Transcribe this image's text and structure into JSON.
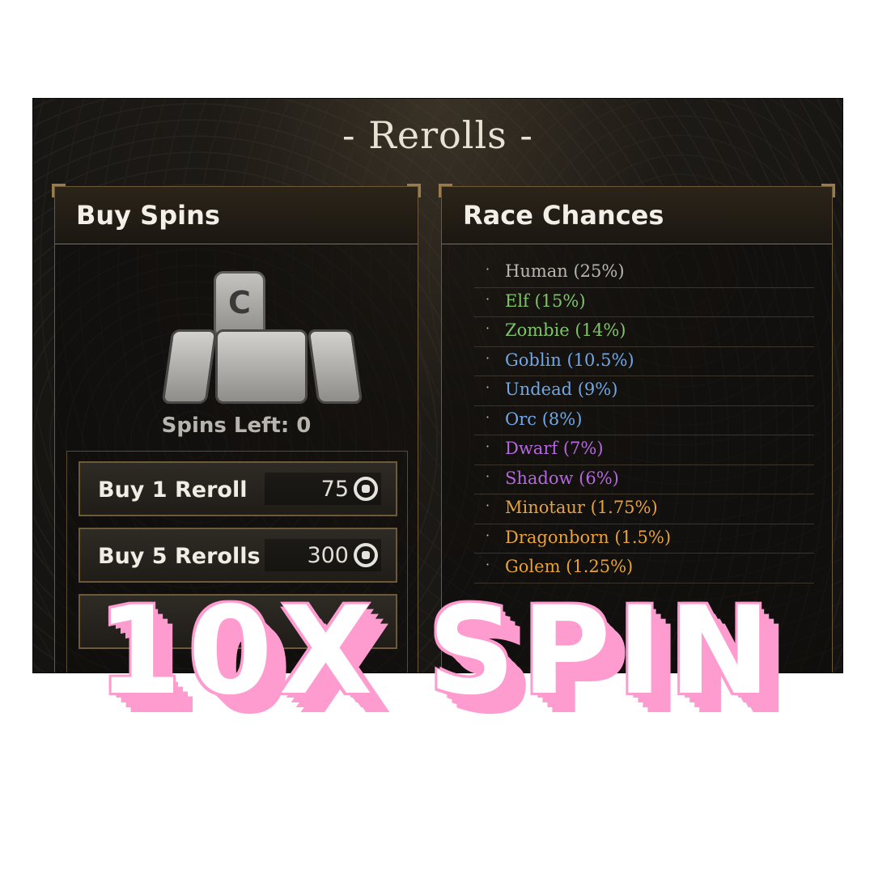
{
  "panel": {
    "title": "- Rerolls -"
  },
  "buy_spins": {
    "header": "Buy Spins",
    "icon": "reroll-character-icon",
    "icon_glyph": "C",
    "spins_left": "Spins Left: 0",
    "options": [
      {
        "label": "Buy 1 Reroll",
        "price": "75",
        "currency_icon": "robux-icon"
      },
      {
        "label": "Buy 5 Rerolls",
        "price": "300",
        "currency_icon": "robux-icon"
      }
    ]
  },
  "race_chances": {
    "header": "Race Chances",
    "items": [
      {
        "text": "Human (25%)",
        "color": "#b9b6ae"
      },
      {
        "text": "Elf (15%)",
        "color": "#7fc46a"
      },
      {
        "text": "Zombie (14%)",
        "color": "#7fc46a"
      },
      {
        "text": "Goblin (10.5%)",
        "color": "#6fa8e8"
      },
      {
        "text": "Undead (9%)",
        "color": "#6fa8e8"
      },
      {
        "text": "Orc (8%)",
        "color": "#6fa8e8"
      },
      {
        "text": "Dwarf (7%)",
        "color": "#b467e0"
      },
      {
        "text": "Shadow (6%)",
        "color": "#b467e0"
      },
      {
        "text": "Minotaur (1.75%)",
        "color": "#e8a23a"
      },
      {
        "text": "Dragonborn (1.5%)",
        "color": "#e8a23a"
      },
      {
        "text": "Golem (1.25%)",
        "color": "#e8a23a"
      }
    ]
  },
  "overlay_text": "10X SPIN",
  "colors": {
    "overlay_fill": "#ffffff",
    "overlay_shadow": "#ff9ccf",
    "panel_border": "#6e5a3a"
  }
}
